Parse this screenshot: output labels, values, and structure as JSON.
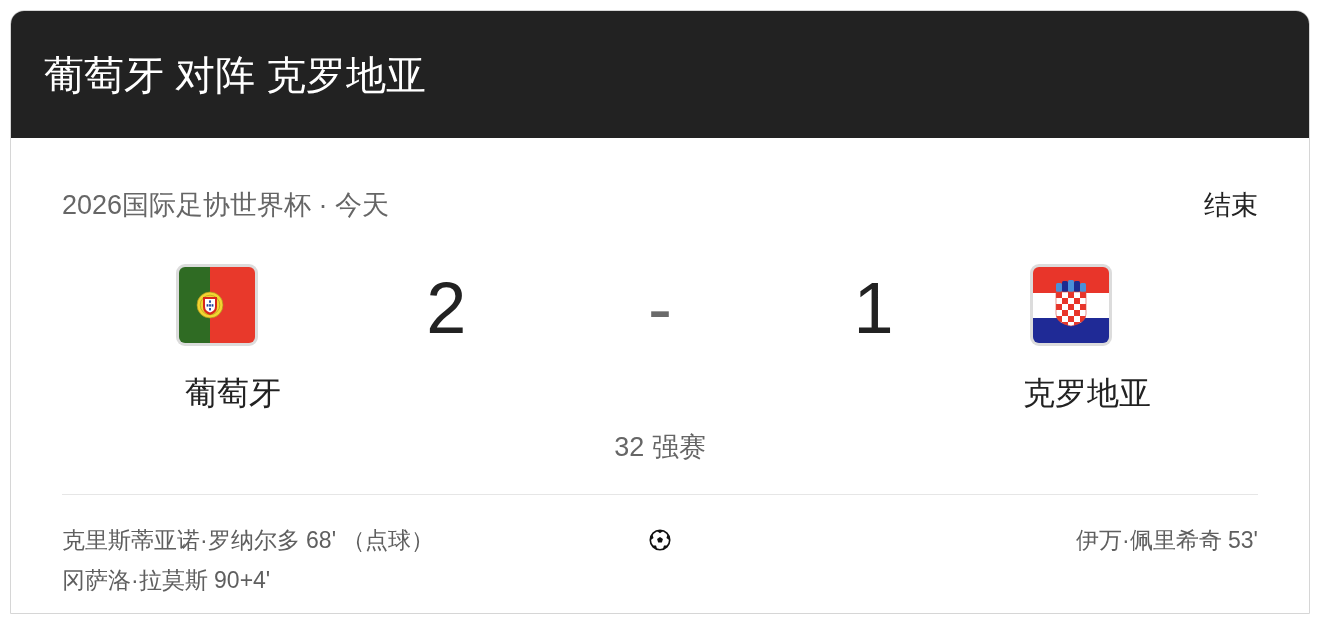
{
  "header": {
    "title": "葡萄牙 对阵 克罗地亚"
  },
  "match": {
    "competition": "2026国际足协世界杯 · 今天",
    "status": "结束",
    "home": {
      "name": "葡萄牙",
      "score": "2"
    },
    "separator": "-",
    "away": {
      "name": "克罗地亚",
      "score": "1"
    },
    "stage": "32 强赛"
  },
  "goals": {
    "home": [
      "克里斯蒂亚诺·罗纳尔多 68' （点球）",
      "冈萨洛·拉莫斯 90+4'"
    ],
    "away": [
      "伊万·佩里希奇 53'"
    ]
  }
}
